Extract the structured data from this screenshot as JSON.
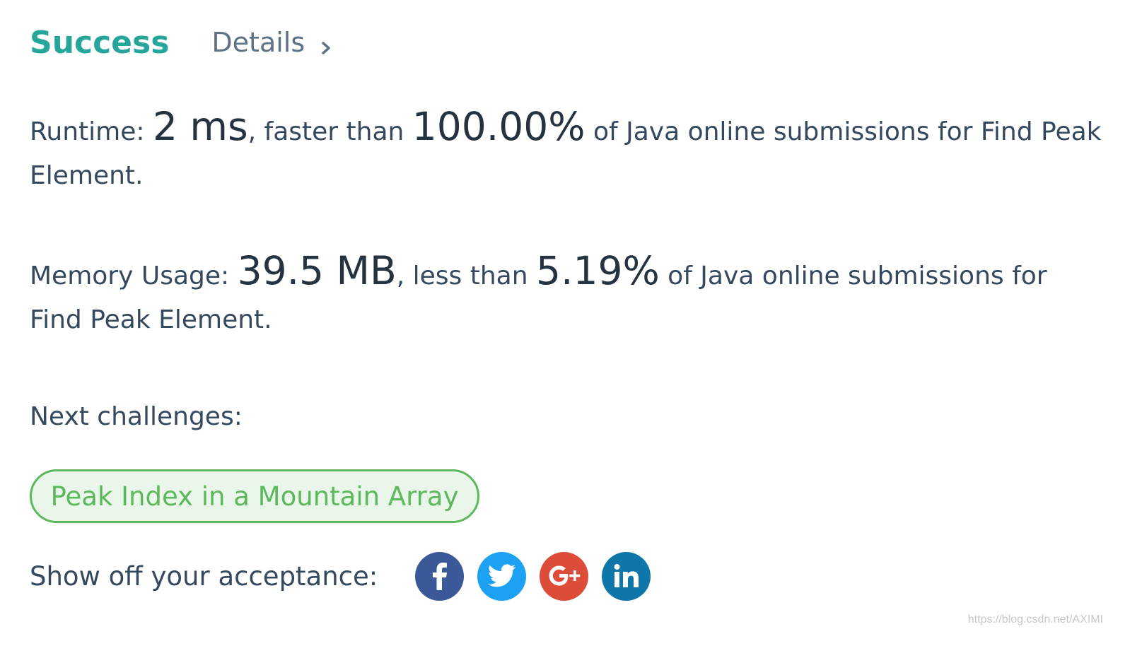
{
  "header": {
    "status": "Success",
    "details_label": "Details",
    "status_color": "#26a69a"
  },
  "runtime": {
    "label": "Runtime: ",
    "value": "2 ms",
    "comparison": ", faster than ",
    "percent": "100.00%",
    "suffix": " of Java online submissions for Find Peak Element."
  },
  "memory": {
    "label": "Memory Usage: ",
    "value": "39.5 MB",
    "comparison": ", less than ",
    "percent": "5.19%",
    "suffix": " of Java online submissions for Find Peak Element."
  },
  "next": {
    "label": "Next challenges:",
    "challenges": [
      {
        "label": "Peak Index in a Mountain Array",
        "color": "#5cb85c"
      }
    ]
  },
  "share": {
    "label": "Show off your acceptance:",
    "buttons": [
      {
        "icon": "facebook-icon",
        "color": "#3b5998"
      },
      {
        "icon": "twitter-icon",
        "color": "#1da1f2"
      },
      {
        "icon": "google-plus-icon",
        "color": "#dd4b39"
      },
      {
        "icon": "linkedin-icon",
        "color": "#0e76a8"
      }
    ]
  },
  "watermark": "https://blog.csdn.net/AXIMI"
}
